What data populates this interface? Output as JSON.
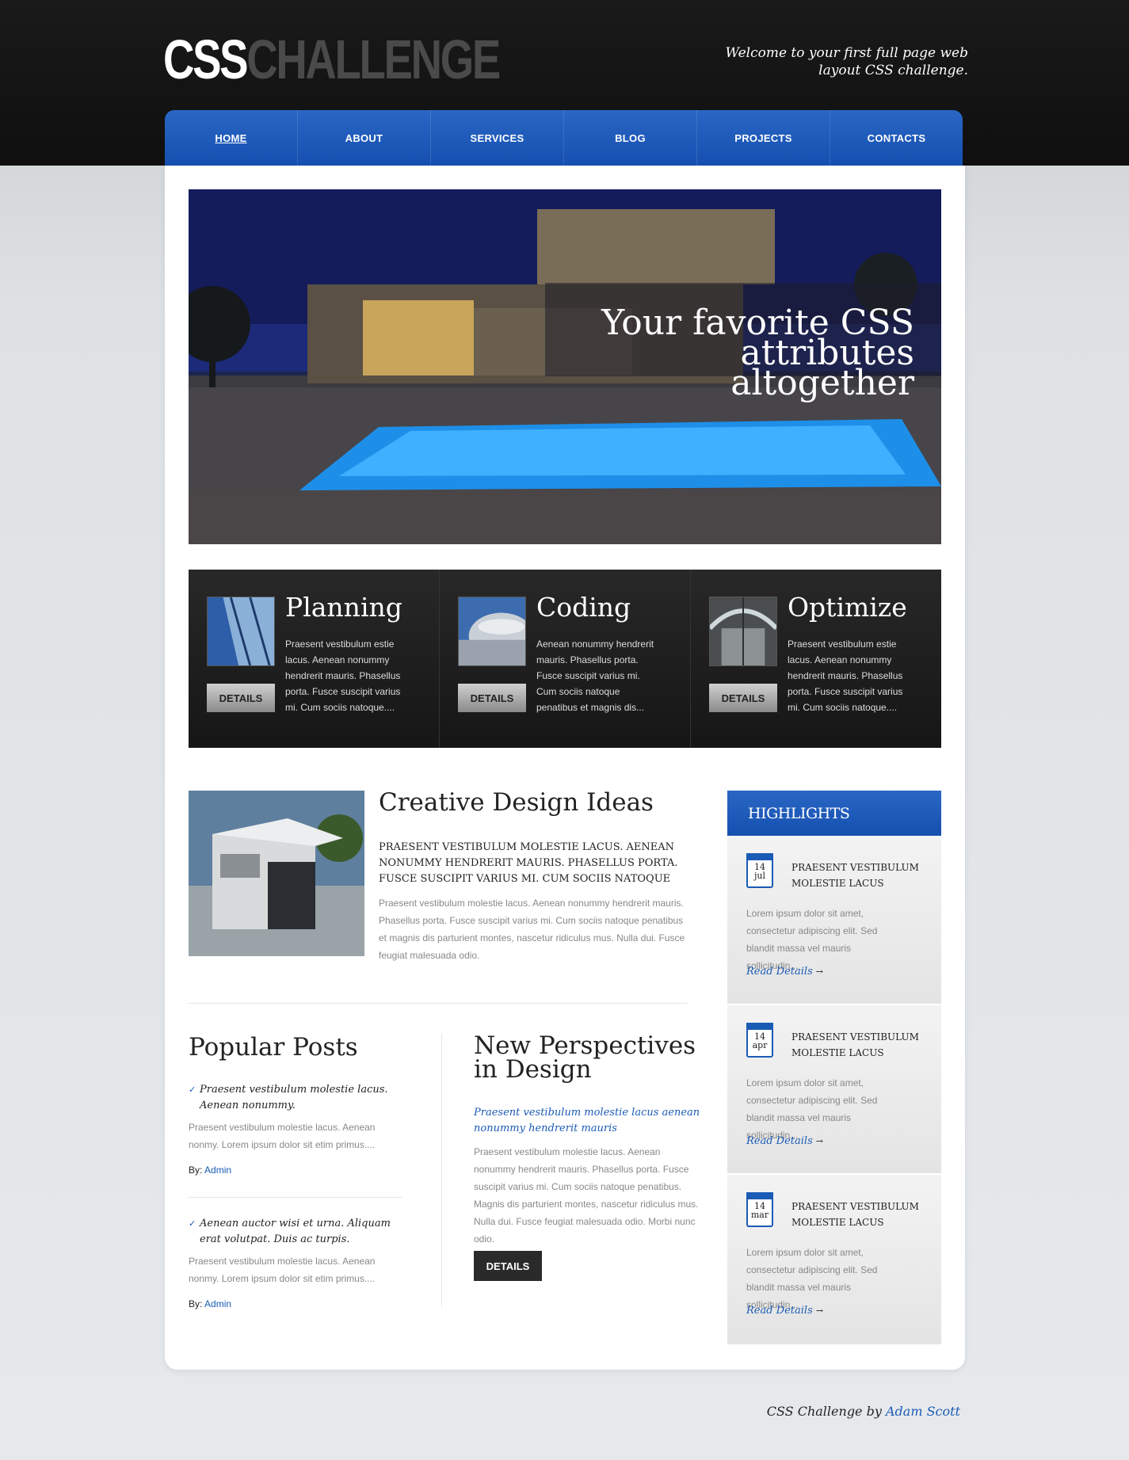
{
  "logo": {
    "part1": "CSS",
    "part2": "CHALLENGE"
  },
  "tagline": "Welcome to your first full page web layout CSS challenge.",
  "nav": {
    "items": [
      {
        "label": "HOME"
      },
      {
        "label": "ABOUT"
      },
      {
        "label": "SERVICES"
      },
      {
        "label": "BLOG"
      },
      {
        "label": "PROJECTS"
      },
      {
        "label": "CONTACTS"
      }
    ],
    "active": "HOME"
  },
  "hero": {
    "title": "Your favorite CSS attributes altogether"
  },
  "features": [
    {
      "title": "Planning",
      "text": "Praesent vestibulum estie lacus. Aenean nonummy hendrerit mauris. Phasellus porta. Fusce suscipit varius mi. Cum sociis natoque....",
      "button": "DETAILS"
    },
    {
      "title": "Coding",
      "text": "Aenean nonummy hendrerit mauris. Phasellus porta. Fusce suscipit varius mi. Cum sociis natoque penatibus et magnis dis...",
      "button": "DETAILS"
    },
    {
      "title": "Optimize",
      "text": "Praesent vestibulum estie lacus. Aenean nonummy hendrerit mauris. Phasellus porta. Fusce suscipit varius mi. Cum sociis natoque....",
      "button": "DETAILS"
    }
  ],
  "creative": {
    "title": "Creative Design Ideas",
    "subtitle": "PRAESENT VESTIBULUM MOLESTIE LACUS. AENEAN NONUMMY HENDRERIT MAURIS. PHASELLUS PORTA. FUSCE SUSCIPIT VARIUS MI. CUM SOCIIS NATOQUE",
    "body": "Praesent vestibulum molestie lacus. Aenean nonummy hendrerit mauris. Phasellus porta. Fusce suscipit varius mi. Cum sociis natoque penatibus et magnis dis parturient montes, nascetur ridiculus mus. Nulla dui. Fusce feugiat malesuada odio."
  },
  "popular": {
    "title": "Popular Posts",
    "posts": [
      {
        "heading": "Praesent vestibulum molestie lacus. Aenean nonummy.",
        "body": "Praesent vestibulum molestie lacus. Aenean nonmy. Lorem ipsum dolor sit etim primus....",
        "by_label": "By:",
        "author": "Admin"
      },
      {
        "heading": "Aenean auctor wisi et urna. Aliquam erat volutpat. Duis ac turpis.",
        "body": "Praesent vestibulum molestie lacus. Aenean nonmy. Lorem ipsum dolor sit etim primus....",
        "by_label": "By:",
        "author": "Admin"
      }
    ]
  },
  "perspectives": {
    "title": "New Perspectives in Design",
    "subtitle": "Praesent vestibulum molestie lacus aenean nonummy hendrerit mauris",
    "body": "Praesent vestibulum molestie lacus. Aenean nonummy hendrerit mauris. Phasellus porta. Fusce suscipit varius mi. Cum sociis natoque penatibus. Magnis dis parturient montes, nascetur ridiculus mus. Nulla dui. Fusce feugiat malesuada odio. Morbi nunc odio.",
    "button": "DETAILS"
  },
  "highlights": {
    "title": "HIGHLIGHTS",
    "items": [
      {
        "day": "14",
        "month": "jul",
        "title": "PRAESENT VESTIBULUM MOLESTIE LACUS",
        "body": "Lorem ipsum dolor sit amet, consectetur adipiscing elit. Sed blandit massa vel mauris sollicitudin...",
        "link": "Read Details"
      },
      {
        "day": "14",
        "month": "apr",
        "title": "PRAESENT VESTIBULUM MOLESTIE LACUS",
        "body": "Lorem ipsum dolor sit amet, consectetur adipiscing elit. Sed blandit massa vel mauris sollicitudin...",
        "link": "Read Details"
      },
      {
        "day": "14",
        "month": "mar",
        "title": "PRAESENT VESTIBULUM MOLESTIE LACUS",
        "body": "Lorem ipsum dolor sit amet, consectetur adipiscing elit. Sed blandit massa vel mauris sollicitudin...",
        "link": "Read Details"
      }
    ]
  },
  "footer": {
    "text": "CSS Challenge by",
    "author": "Adam Scott"
  },
  "colors": {
    "brand_blue": "#1a5bb5",
    "dark": "#141414"
  }
}
